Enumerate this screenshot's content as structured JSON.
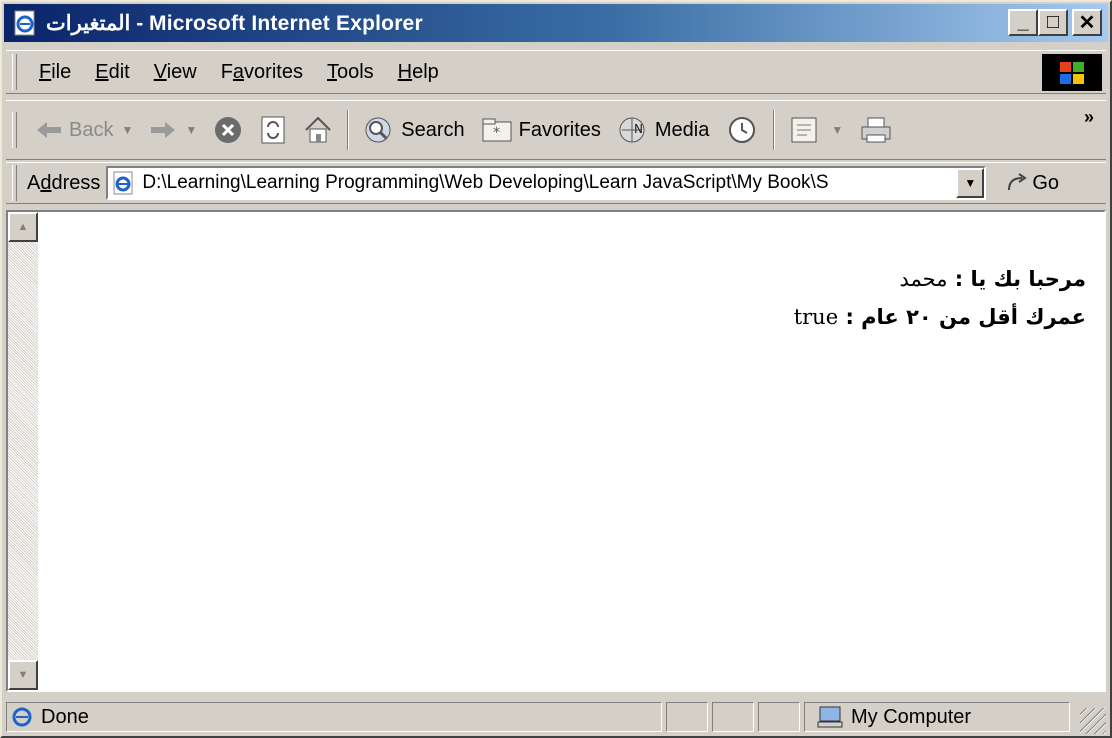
{
  "window": {
    "title_arabic": "المتغيرات",
    "title_rest": " - Microsoft Internet Explorer",
    "minimize": "_",
    "maximize": "□",
    "close": "✕"
  },
  "menu": {
    "items": [
      {
        "accel": "F",
        "rest": "ile"
      },
      {
        "accel": "E",
        "rest": "dit"
      },
      {
        "accel": "V",
        "rest": "iew"
      },
      {
        "pre": "F",
        "accel": "a",
        "rest": "vorites"
      },
      {
        "accel": "T",
        "rest": "ools"
      },
      {
        "accel": "H",
        "rest": "elp"
      }
    ]
  },
  "toolbar": {
    "back_label": "Back",
    "search_label": "Search",
    "favorites_label": "Favorites",
    "media_label": "Media",
    "more": "»"
  },
  "address": {
    "label_pre": "A",
    "label_accel": "d",
    "label_rest": "dress",
    "url": "D:\\Learning\\Learning Programming\\Web Developing\\Learn JavaScript\\My Book\\S",
    "go_label": "Go"
  },
  "page": {
    "line1_label": "مرحبا بك يا : ",
    "line1_value": "محمد",
    "line2_label": "عمرك أقل من ٢٠ عام : ",
    "line2_value": "true"
  },
  "status": {
    "text": "Done",
    "zone": "My Computer"
  },
  "icons": [
    "ie-page-icon",
    "windows-logo-icon",
    "back-arrow-icon",
    "forward-arrow-icon",
    "stop-icon",
    "refresh-icon",
    "home-icon",
    "search-icon",
    "favorites-icon",
    "media-icon",
    "history-icon",
    "mail-icon",
    "print-icon",
    "go-arrow-icon",
    "computer-icon"
  ]
}
